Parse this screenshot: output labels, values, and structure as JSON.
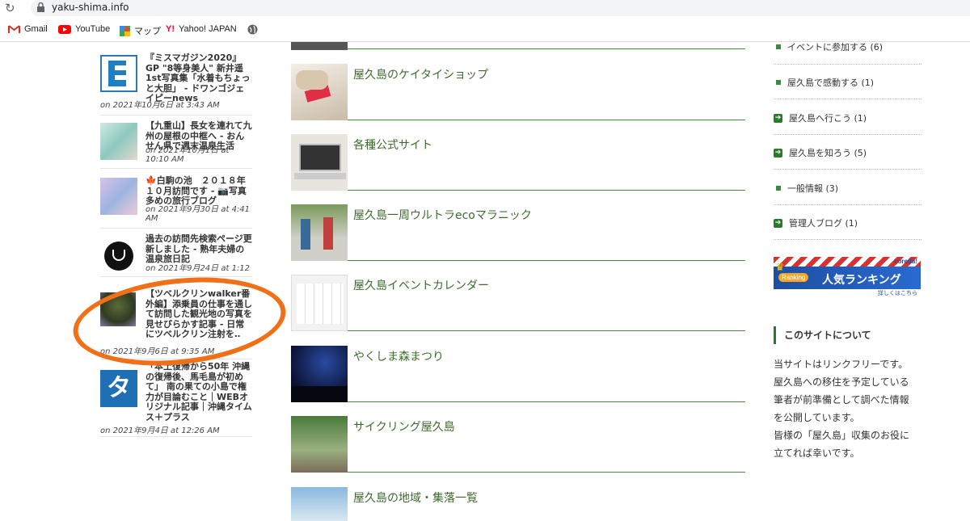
{
  "browser": {
    "url": "yaku-shima.info",
    "bookmarks": [
      {
        "label": "Gmail",
        "icon": "gmail-icon"
      },
      {
        "label": "YouTube",
        "icon": "youtube-icon"
      },
      {
        "label": "マップ",
        "icon": "maps-icon"
      },
      {
        "label": "Yahoo! JAPAN",
        "icon": "yahoo-icon"
      },
      {
        "label": "",
        "icon": "globe-icon"
      }
    ]
  },
  "left": {
    "posts": [
      {
        "title": "『ミスマガジン2020』GP \"8等身美人\" 新井遥 1st写真集「水着もちょっと大胆」 - ドワンゴジェイピーnews",
        "date": "on 2021年10月6日 at 3:43 AM"
      },
      {
        "title": "【九重山】長女を連れて九州の屋根の中框へ - おんせん県で週末温泉生活",
        "date": "on 2021年10月1日 at 10:10 AM"
      },
      {
        "title": "🍁白駒の池　２０１８年１０月訪問です - 📷写真多めの旅行ブログ",
        "date": "on 2021年9月30日 at 4:41 AM"
      },
      {
        "title": "過去の訪問先検索ページ更新しました - 熟年夫婦の温泉旅日記",
        "date": "on 2021年9月24日 at 1:12"
      },
      {
        "title": "【ツベルクリンwalker番外編】添乗員の仕事を通して訪問した観光地の写真を見せびらかす記事 - 日常にツベルクリン注射を‥",
        "date": "on 2021年9月6日 at 9:35 AM"
      },
      {
        "title": "「本土復帰から50年 沖縄の復帰後、馬毛島が初めて」 南の果ての小島で権力が目論むこと｜WEBオリジナル記事｜沖縄タイムス＋プラス",
        "date": "on 2021年9月4日 at 12:26 AM"
      }
    ]
  },
  "middle": {
    "cards": [
      {
        "title": "屋久島のケイタイショップ"
      },
      {
        "title": "各種公式サイト"
      },
      {
        "title": "屋久島一周ウルトラecoマラニック"
      },
      {
        "title": "屋久島イベントカレンダー"
      },
      {
        "title": "やくしま森まつり"
      },
      {
        "title": "サイクリング屋久島"
      },
      {
        "title": "屋久島の地域・集落一覧"
      }
    ]
  },
  "right": {
    "categories": [
      {
        "label": "イベントに参加する (6)",
        "icon": "bullet"
      },
      {
        "label": "屋久島で感動する (1)",
        "icon": "bullet"
      },
      {
        "label": "屋久島へ行こう (1)",
        "icon": "arrow"
      },
      {
        "label": "屋久島を知ろう (5)",
        "icon": "arrow"
      },
      {
        "label": "一般情報 (3)",
        "icon": "bullet"
      },
      {
        "label": "管理人ブログ (1)",
        "icon": "arrow"
      }
    ],
    "ad": {
      "brand": "coreda!",
      "badge": "Ranking",
      "title": "人気ランキング",
      "cta": "詳しくはこちら"
    },
    "about": {
      "heading": "このサイトについて",
      "lines": [
        "当サイトはリンクフリーです。",
        "屋久島への移住を予定している",
        "筆者が前準備として調べた情報",
        "を公開しています。",
        "皆様の「屋久島」収集のお役に",
        "立てれば幸いです。"
      ]
    }
  },
  "colors": {
    "accent": "#3d6b2d",
    "annotation": "#f07018"
  }
}
